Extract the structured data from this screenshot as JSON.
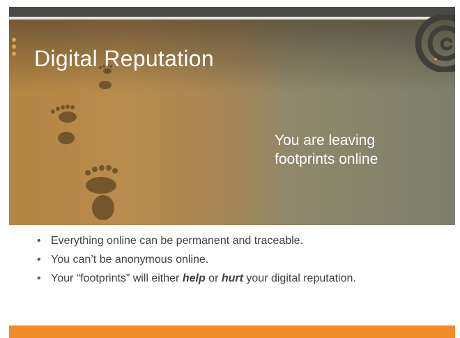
{
  "slide": {
    "title": "Digital Reputation",
    "subtitle_line1": "You are leaving",
    "subtitle_line2": "footprints online",
    "bullets": [
      {
        "text": "Everything online can be permanent and traceable."
      },
      {
        "text": "You can’t be anonymous online."
      },
      {
        "pre": "Your “footprints” will either ",
        "bold1": "help",
        "mid": " or ",
        "bold2": "hurt",
        "post": " your digital reputation."
      }
    ]
  },
  "colors": {
    "accent_orange": "#f08a2b",
    "top_band": "#4a4a46",
    "sand": "#b88c4f",
    "bullet_text": "#404040"
  },
  "icons": [
    "decorative-dots-icon",
    "spiral-logo-icon",
    "footprint-icon"
  ]
}
